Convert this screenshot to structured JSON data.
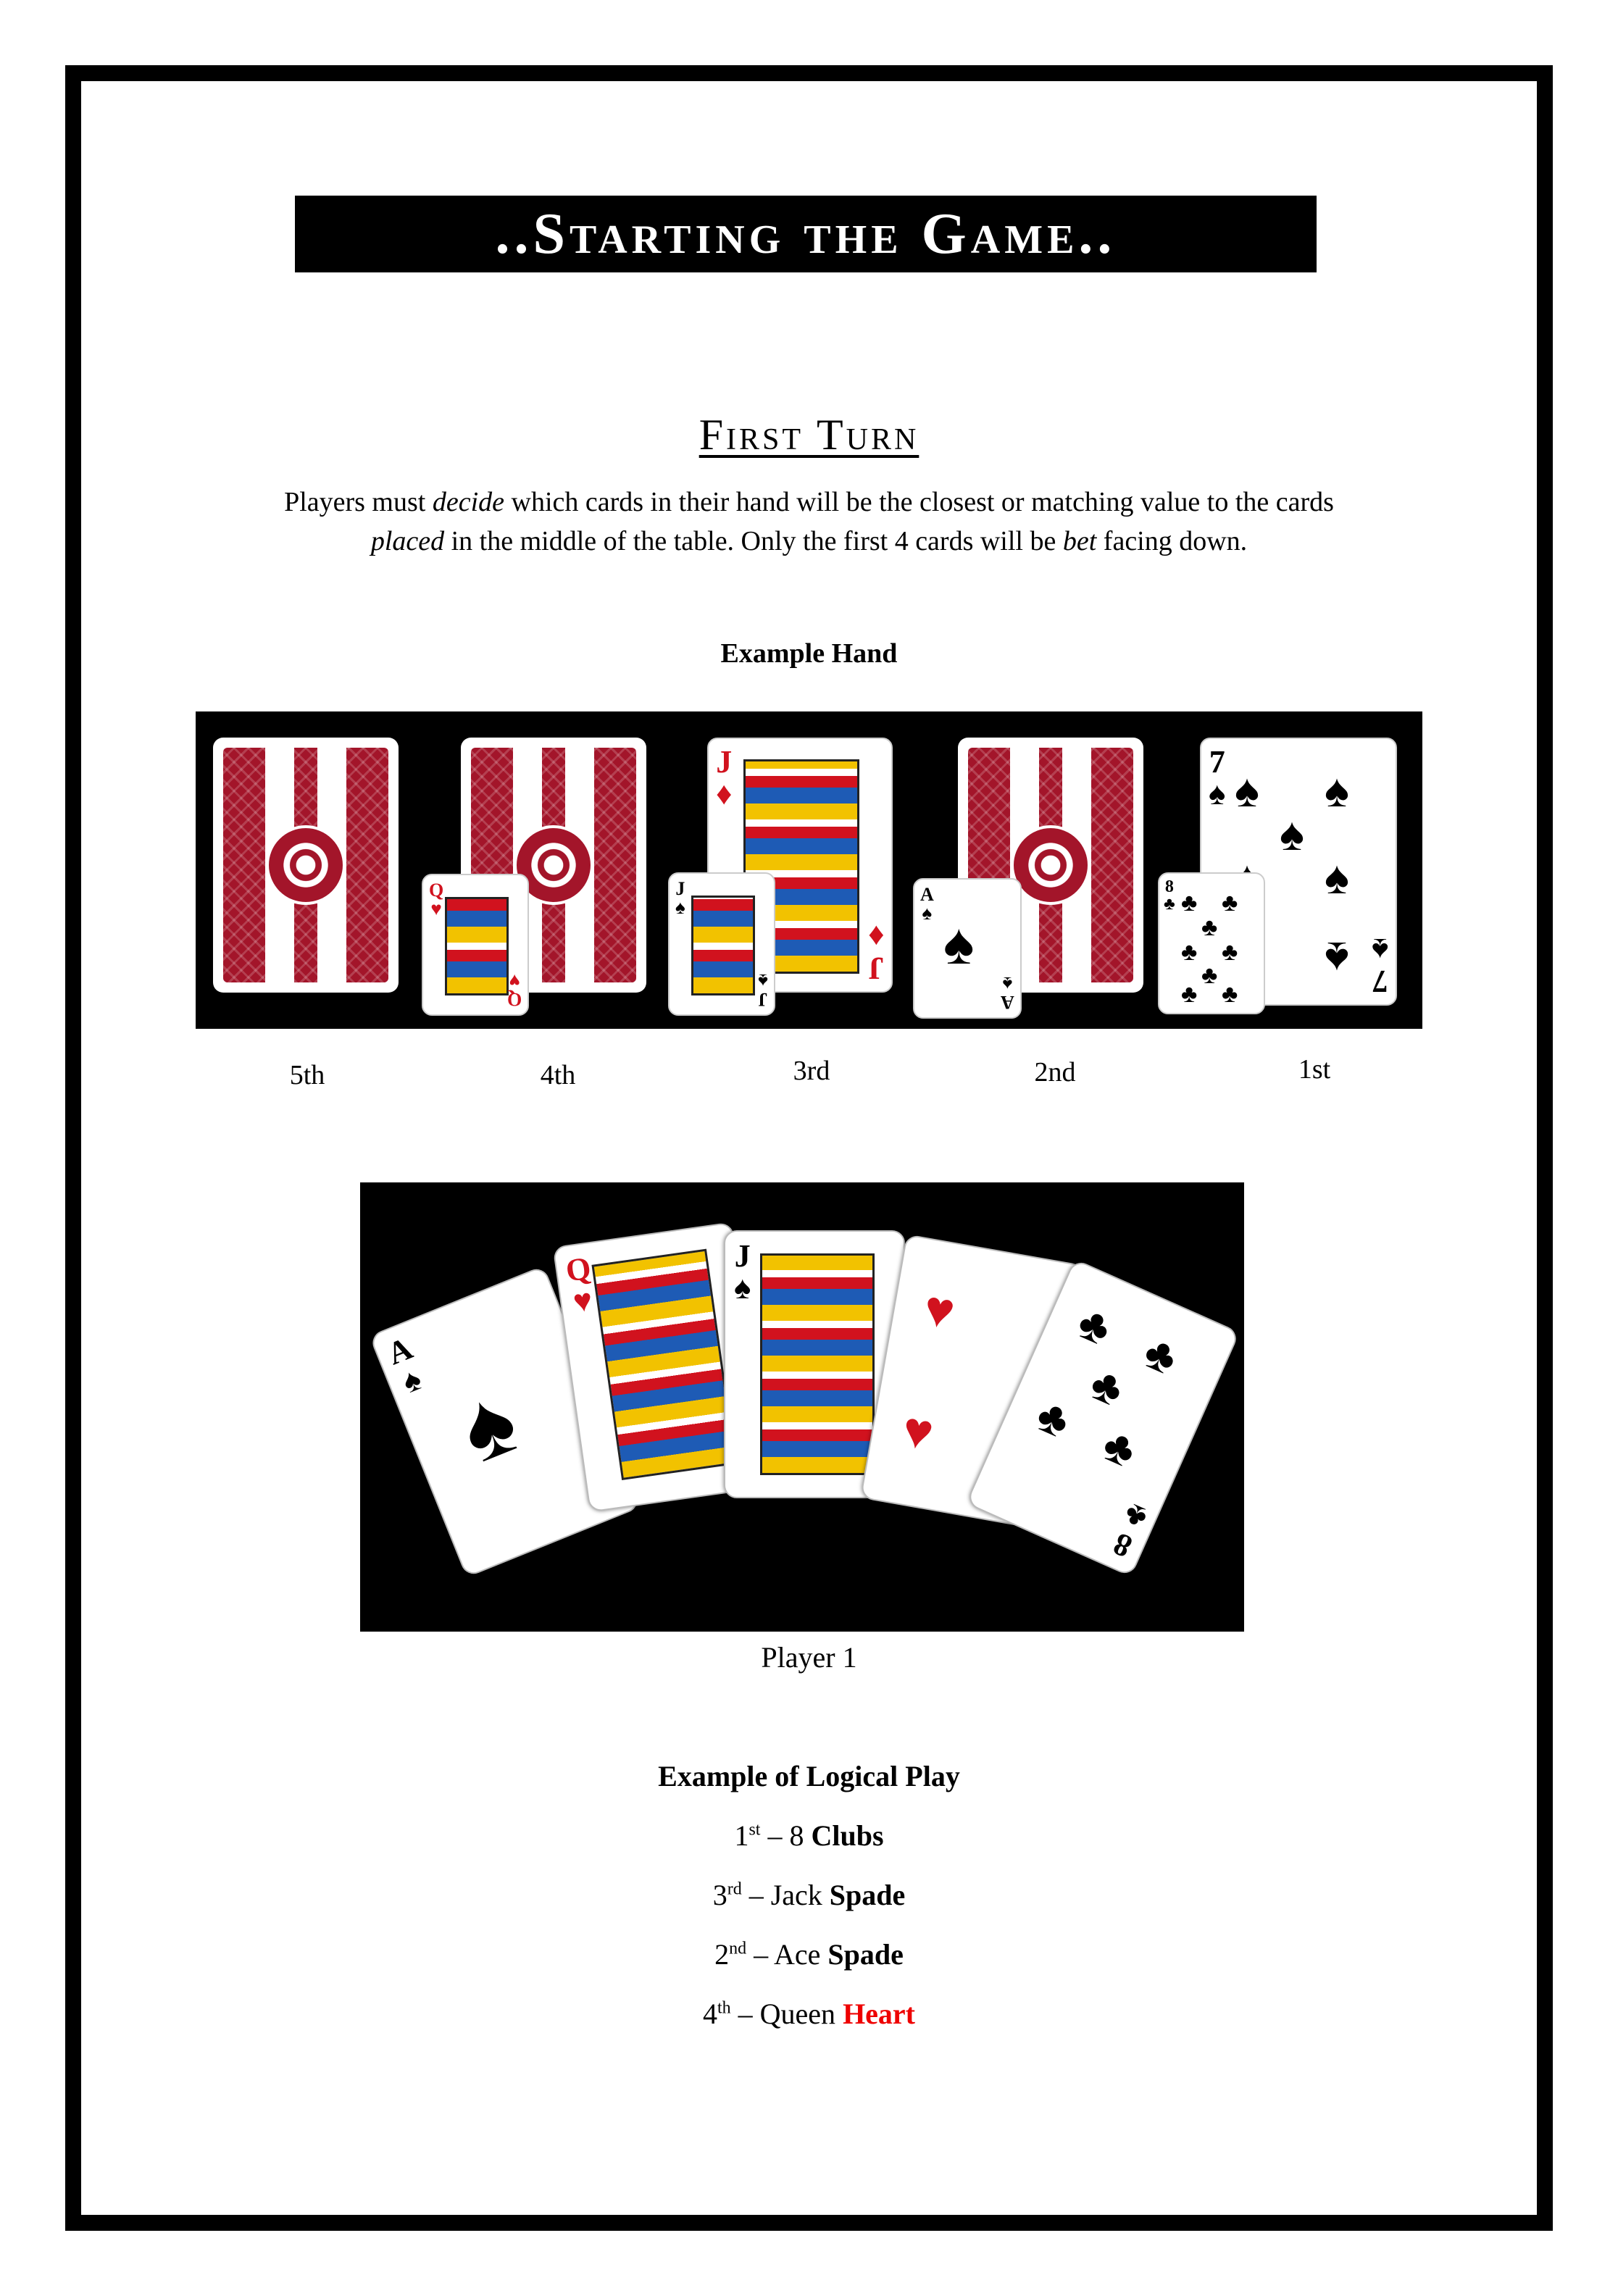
{
  "title": "..Starting the Game..",
  "subtitle": "First Turn",
  "paragraph": {
    "line1_a": "Players must ",
    "line1_em": "decide",
    "line1_b": " which cards in their hand will be the closest or matching value to the cards",
    "line2_em1": "placed",
    "line2_a": " in the middle of the table. Only the first 4 cards will be ",
    "line2_em2": "bet",
    "line2_b": " facing down."
  },
  "example_hand_heading": "Example Hand",
  "example_hand": {
    "slots": [
      {
        "label": "5th",
        "table_card": "back",
        "bet_card": null
      },
      {
        "label": "4th",
        "table_card": "back",
        "bet_card": {
          "rank": "Q",
          "suit": "♥",
          "color": "#d1121e"
        }
      },
      {
        "label": "3rd",
        "table_card": {
          "rank": "J",
          "suit": "♦",
          "color": "#d1121e"
        },
        "bet_card": {
          "rank": "J",
          "suit": "♠",
          "color": "#000000"
        }
      },
      {
        "label": "2nd",
        "table_card": "back",
        "bet_card": {
          "rank": "A",
          "suit": "♠",
          "color": "#000000"
        }
      },
      {
        "label": "1st",
        "table_card": {
          "rank": "7",
          "suit": "♠",
          "color": "#000000"
        },
        "bet_card": {
          "rank": "8",
          "suit": "♣",
          "color": "#000000"
        }
      }
    ]
  },
  "player_hand": {
    "caption": "Player 1",
    "cards": [
      {
        "rank": "A",
        "suit": "♠",
        "color": "#000000"
      },
      {
        "rank": "Q",
        "suit": "♥",
        "color": "#d1121e"
      },
      {
        "rank": "J",
        "suit": "♠",
        "color": "#000000"
      },
      {
        "rank": "4",
        "suit": "♥",
        "color": "#d1121e"
      },
      {
        "rank": "8",
        "suit": "♣",
        "color": "#000000"
      }
    ]
  },
  "logical_play": {
    "heading": "Example of Logical Play",
    "lines": [
      {
        "num": "1",
        "ord": "st",
        "dash": " – ",
        "card": "8 ",
        "suit": "Clubs"
      },
      {
        "num": "3",
        "ord": "rd",
        "dash": " – ",
        "card": "Jack ",
        "suit": "Spade"
      },
      {
        "num": "2",
        "ord": "nd",
        "dash": " – ",
        "card": "Ace ",
        "suit": "Spade"
      },
      {
        "num": "4",
        "ord": "th",
        "dash": " – ",
        "card": "Queen ",
        "suit": "Heart"
      }
    ]
  },
  "colors": {
    "heart_text": "#ee0000",
    "card_back": "#a3152a",
    "card_red": "#d1121e"
  }
}
